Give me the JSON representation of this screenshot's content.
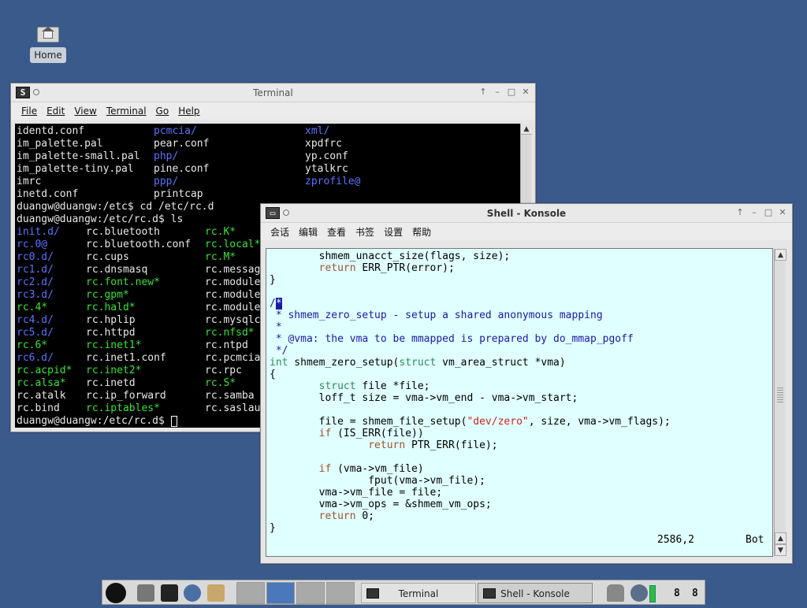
{
  "desktop": {
    "home_label": "Home"
  },
  "terminal": {
    "title": "Terminal",
    "menu": [
      "File",
      "Edit",
      "View",
      "Terminal",
      "Go",
      "Help"
    ],
    "listing_top": [
      [
        "identd.conf",
        "pcmcia/",
        "xml/"
      ],
      [
        "im_palette.pal",
        "pear.conf",
        "xpdfrc"
      ],
      [
        "im_palette-small.pal",
        "php/",
        "yp.conf"
      ],
      [
        "im_palette-tiny.pal",
        "pine.conf",
        "ytalkrc"
      ],
      [
        "imrc",
        "ppp/",
        "zprofile@"
      ],
      [
        "inetd.conf",
        "printcap",
        ""
      ]
    ],
    "cmd1": "duangw@duangw:/etc$ cd /etc/rc.d",
    "cmd2": "duangw@duangw:/etc/rc.d$ ls",
    "listing_rc": [
      [
        "init.d/",
        "rc.bluetooth",
        "rc.K*"
      ],
      [
        "rc.0@",
        "rc.bluetooth.conf",
        "rc.local*"
      ],
      [
        "rc0.d/",
        "rc.cups",
        "rc.M*"
      ],
      [
        "rc1.d/",
        "rc.dnsmasq",
        "rc.messag"
      ],
      [
        "rc2.d/",
        "rc.font.new*",
        "rc.module"
      ],
      [
        "rc3.d/",
        "rc.gpm*",
        "rc.module"
      ],
      [
        "rc.4*",
        "rc.hald*",
        "rc.module"
      ],
      [
        "rc4.d/",
        "rc.hplip",
        "rc.mysqlc"
      ],
      [
        "rc5.d/",
        "rc.httpd",
        "rc.nfsd*"
      ],
      [
        "rc.6*",
        "rc.inet1*",
        "rc.ntpd"
      ],
      [
        "rc6.d/",
        "rc.inet1.conf",
        "rc.pcmcia"
      ],
      [
        "rc.acpid*",
        "rc.inet2*",
        "rc.rpc"
      ],
      [
        "rc.alsa*",
        "rc.inetd",
        "rc.S*"
      ],
      [
        "rc.atalk",
        "rc.ip_forward",
        "rc.samba"
      ],
      [
        "rc.bind",
        "rc.iptables*",
        "rc.saslau"
      ]
    ],
    "prompt": "duangw@duangw:/etc/rc.d$ "
  },
  "konsole": {
    "title": "Shell - Konsole",
    "menu": [
      "会话",
      "编辑",
      "查看",
      "书签",
      "设置",
      "帮助"
    ],
    "code": {
      "l1": "        shmem_unacct_size(flags, size);",
      "l2_kw": "return",
      "l2_rest": " ERR_PTR(error);",
      "l3": "}",
      "l5_open": "/",
      "l5_star": "*",
      "l6": " * shmem_zero_setup - setup a shared anonymous mapping",
      "l7": " *",
      "l8": " * @vma: the vma to be mmapped is prepared by do_mmap_pgoff",
      "l9": " */",
      "l10_type": "int",
      "l10_mid": " shmem_zero_setup(",
      "l10_struct": "struct",
      "l10_rest": " vm_area_struct *vma)",
      "l11": "{",
      "l12_struct": "struct",
      "l12_rest": " file *file;",
      "l13": "        loff_t size = vma->vm_end - vma->vm_start;",
      "l15_a": "        file = shmem_file_setup(",
      "l15_str": "\"dev/zero\"",
      "l15_b": ", size, vma->vm_flags);",
      "l16_kw": "if",
      "l16_rest": " (IS_ERR(file))",
      "l17_kw": "return",
      "l17_rest": " PTR_ERR(file);",
      "l19_kw": "if",
      "l19_rest": " (vma->vm_file)",
      "l20": "                fput(vma->vm_file);",
      "l21": "        vma->vm_file = file;",
      "l22": "        vma->vm_ops = &shmem_vm_ops;",
      "l23_kw": "return",
      "l23_rest": " 0;",
      "l24": "}",
      "status_pos": "2586,2",
      "status_where": "Bot"
    }
  },
  "taskbar": {
    "task_terminal": "Terminal",
    "task_konsole": "Shell - Konsole",
    "clock_a": "8",
    "clock_b": "8"
  }
}
